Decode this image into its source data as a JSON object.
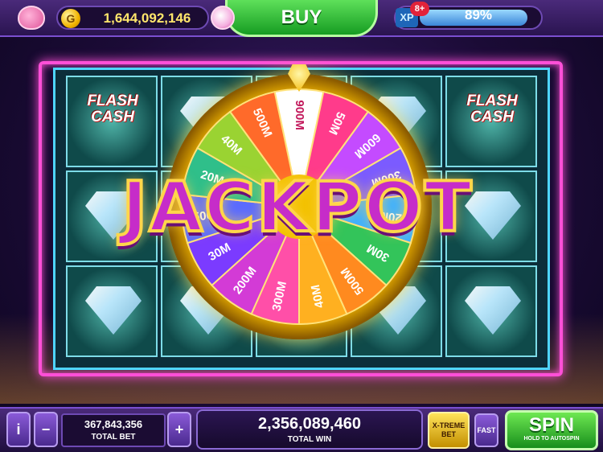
{
  "top_bar": {
    "coins": "1,644,092,146",
    "coin_symbol": "G",
    "buy_label": "BUY",
    "xp_label": "XP",
    "xp_badge": "8+",
    "xp_percent": "89%",
    "xp_progress": 0.89
  },
  "reels": {
    "symbol_text": "FLASH CASH",
    "grid": [
      [
        "flash-cash",
        "diamond",
        "diamond",
        "diamond",
        "flash-cash"
      ],
      [
        "diamond",
        "diamond",
        "diamond",
        "diamond",
        "diamond"
      ],
      [
        "diamond",
        "diamond",
        "diamond",
        "diamond",
        "diamond"
      ]
    ]
  },
  "wheel": {
    "segments": [
      "900M",
      "50M",
      "600M",
      "300M",
      "20M",
      "30M",
      "500M",
      "40M",
      "300M",
      "200M",
      "30M",
      "500M",
      "20M",
      "40M",
      "500M"
    ],
    "colors": [
      "#ffffff",
      "#ff3b8b",
      "#c44bff",
      "#7b5bff",
      "#3fb1ff",
      "#33c45a",
      "#ff8a1f",
      "#ffb020",
      "#ff4fa8",
      "#d33bd6",
      "#7b3bff",
      "#5a6bff",
      "#2fbf8a",
      "#9ad332",
      "#ff6a2a"
    ]
  },
  "jackpot_text": "JACKPOT",
  "bottom_bar": {
    "info_label": "i",
    "minus_label": "−",
    "plus_label": "+",
    "total_bet": "367,843,356",
    "total_bet_label": "TOTAL BET",
    "total_win": "2,356,089,460",
    "total_win_label": "TOTAL WIN",
    "xtreme_label": "X-TREME BET",
    "fast_label": "FAST",
    "spin_label": "SPIN",
    "spin_sub": "HOLD TO AUTOSPIN"
  }
}
